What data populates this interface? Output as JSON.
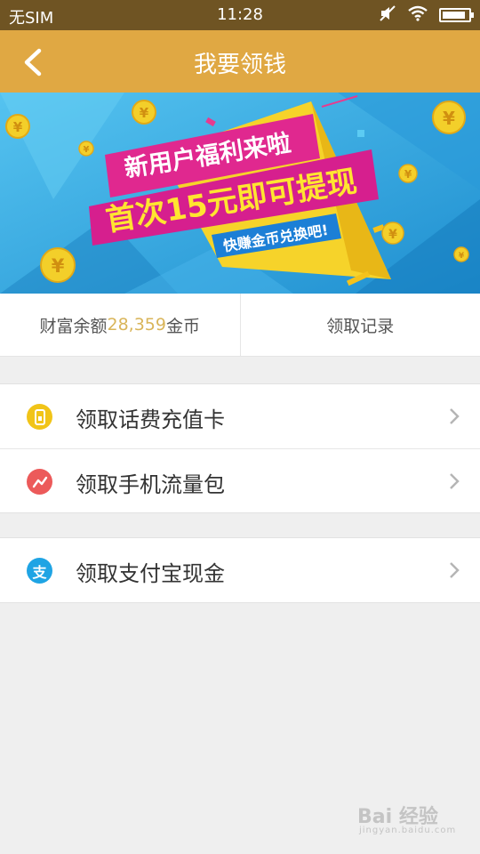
{
  "status_bar": {
    "carrier": "无SIM",
    "time": "11:28",
    "battery_level": 0.9
  },
  "header": {
    "title": "我要领钱"
  },
  "banner": {
    "line1": "新用户福利来啦",
    "line2": "首次15元即可提现",
    "tag": "快赚金币兑换吧!",
    "coin_symbol": "¥",
    "colors": {
      "sky": "#3aaee6",
      "ribbon": "#d61f8e",
      "yellow": "#f6d32a",
      "tag_blue": "#1c7fd6"
    }
  },
  "balance": {
    "label_prefix": "财富余额",
    "amount": "28,359",
    "label_suffix": "金币",
    "record_label": "领取记录"
  },
  "menu_groups": [
    [
      {
        "label": "领取话费充值卡",
        "icon": "phone-card-icon",
        "icon_color": "#f1c418"
      },
      {
        "label": "领取手机流量包",
        "icon": "data-flow-icon",
        "icon_color": "#ec5a5a"
      }
    ],
    [
      {
        "label": "领取支付宝现金",
        "icon": "alipay-icon",
        "icon_color": "#1fa4e4",
        "icon_glyph": "支"
      }
    ]
  ],
  "watermark": {
    "text": "Bai 经验",
    "sub": "jingyan.baidu.com"
  }
}
